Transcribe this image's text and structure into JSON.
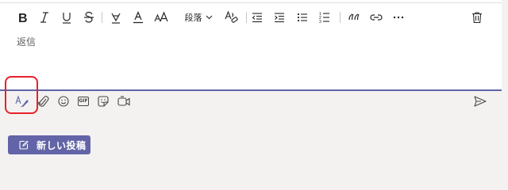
{
  "composer": {
    "paragraph_style_label": "段落",
    "message_text": "返信"
  },
  "toolbar_icons": [
    "bold-icon",
    "italic-icon",
    "underline-icon",
    "strikethrough-icon",
    "highlight-icon",
    "font-color-icon",
    "font-size-icon",
    "paragraph-dropdown",
    "clear-formatting-icon",
    "decrease-indent-icon",
    "increase-indent-icon",
    "bulleted-list-icon",
    "numbered-list-icon",
    "quote-icon",
    "link-icon",
    "more-options-icon",
    "delete-icon"
  ],
  "action_icons": [
    "format-icon",
    "attach-icon",
    "emoji-icon",
    "gif-icon",
    "sticker-icon",
    "meet-now-icon",
    "send-icon"
  ],
  "gif_label": "GIF",
  "new_post_button": {
    "label": "新しい投稿"
  },
  "colors": {
    "accent": "#6264a7",
    "highlight_ring": "#e8212b",
    "background": "#f3f2f1"
  }
}
